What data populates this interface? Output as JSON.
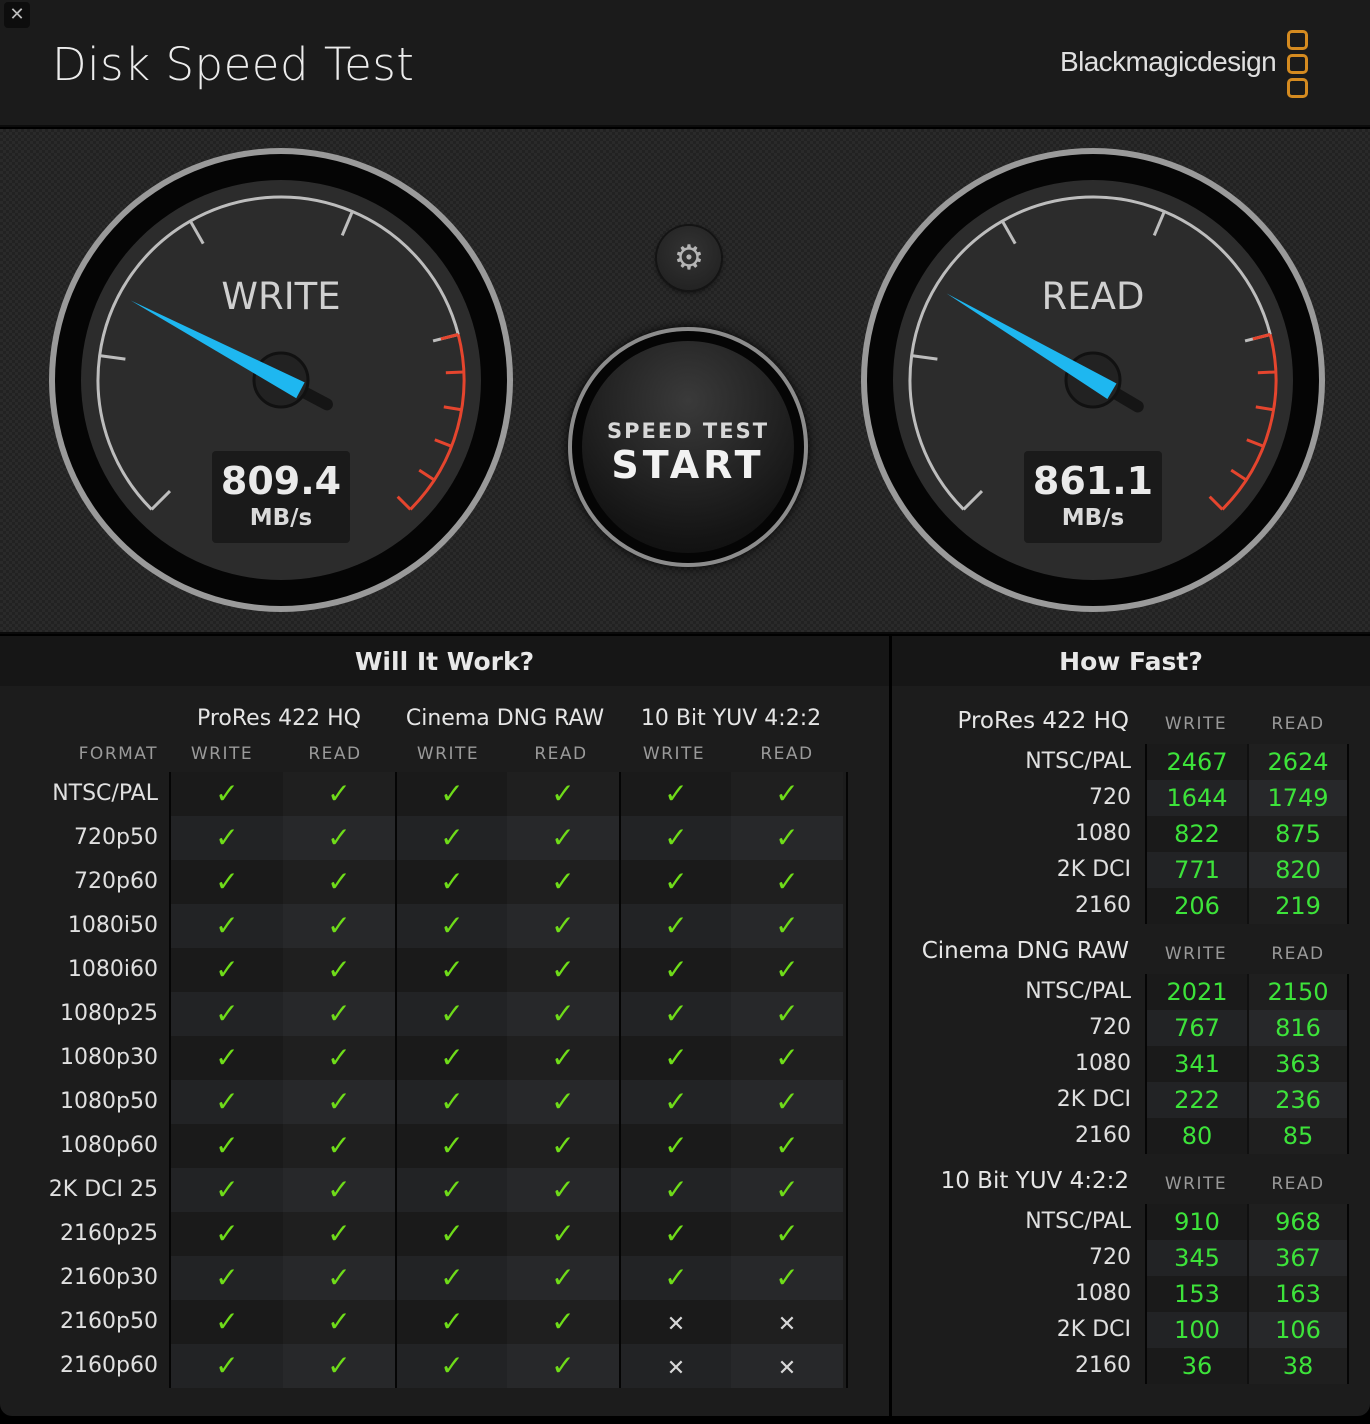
{
  "window": {
    "close_label": "✕"
  },
  "header": {
    "title": "Disk Speed Test",
    "brand": "Blackmagicdesign",
    "brand_color": "#d58b20"
  },
  "gauges": {
    "write": {
      "label": "WRITE",
      "value": "809.4",
      "unit": "MB/s",
      "needle_fraction": 0.27
    },
    "read": {
      "label": "READ",
      "value": "861.1",
      "unit": "MB/s",
      "needle_fraction": 0.28
    },
    "needle_color": "#1eb7f0",
    "redzone_color": "#e5452e"
  },
  "controls": {
    "settings_icon": "gear-icon",
    "start_sub_label": "SPEED TEST",
    "start_label": "START"
  },
  "will_it_work": {
    "title": "Will It Work?",
    "format_header": "FORMAT",
    "codecs": [
      "ProRes 422 HQ",
      "Cinema DNG RAW",
      "10 Bit YUV 4:2:2"
    ],
    "sub_headers": [
      "WRITE",
      "READ",
      "WRITE",
      "READ",
      "WRITE",
      "READ"
    ],
    "rows": [
      {
        "format": "NTSC/PAL",
        "results": [
          true,
          true,
          true,
          true,
          true,
          true
        ]
      },
      {
        "format": "720p50",
        "results": [
          true,
          true,
          true,
          true,
          true,
          true
        ]
      },
      {
        "format": "720p60",
        "results": [
          true,
          true,
          true,
          true,
          true,
          true
        ]
      },
      {
        "format": "1080i50",
        "results": [
          true,
          true,
          true,
          true,
          true,
          true
        ]
      },
      {
        "format": "1080i60",
        "results": [
          true,
          true,
          true,
          true,
          true,
          true
        ]
      },
      {
        "format": "1080p25",
        "results": [
          true,
          true,
          true,
          true,
          true,
          true
        ]
      },
      {
        "format": "1080p30",
        "results": [
          true,
          true,
          true,
          true,
          true,
          true
        ]
      },
      {
        "format": "1080p50",
        "results": [
          true,
          true,
          true,
          true,
          true,
          true
        ]
      },
      {
        "format": "1080p60",
        "results": [
          true,
          true,
          true,
          true,
          true,
          true
        ]
      },
      {
        "format": "2K DCI 25",
        "results": [
          true,
          true,
          true,
          true,
          true,
          true
        ]
      },
      {
        "format": "2160p25",
        "results": [
          true,
          true,
          true,
          true,
          true,
          true
        ]
      },
      {
        "format": "2160p30",
        "results": [
          true,
          true,
          true,
          true,
          true,
          true
        ]
      },
      {
        "format": "2160p50",
        "results": [
          true,
          true,
          true,
          true,
          false,
          false
        ]
      },
      {
        "format": "2160p60",
        "results": [
          true,
          true,
          true,
          true,
          false,
          false
        ]
      }
    ],
    "check_glyph": "✓",
    "cross_glyph": "✕"
  },
  "how_fast": {
    "title": "How Fast?",
    "write_header": "WRITE",
    "read_header": "READ",
    "sections": [
      {
        "codec": "ProRes 422 HQ",
        "rows": [
          {
            "format": "NTSC/PAL",
            "write": "2467",
            "read": "2624"
          },
          {
            "format": "720",
            "write": "1644",
            "read": "1749"
          },
          {
            "format": "1080",
            "write": "822",
            "read": "875"
          },
          {
            "format": "2K DCI",
            "write": "771",
            "read": "820"
          },
          {
            "format": "2160",
            "write": "206",
            "read": "219"
          }
        ]
      },
      {
        "codec": "Cinema DNG RAW",
        "rows": [
          {
            "format": "NTSC/PAL",
            "write": "2021",
            "read": "2150"
          },
          {
            "format": "720",
            "write": "767",
            "read": "816"
          },
          {
            "format": "1080",
            "write": "341",
            "read": "363"
          },
          {
            "format": "2K DCI",
            "write": "222",
            "read": "236"
          },
          {
            "format": "2160",
            "write": "80",
            "read": "85"
          }
        ]
      },
      {
        "codec": "10 Bit YUV 4:2:2",
        "rows": [
          {
            "format": "NTSC/PAL",
            "write": "910",
            "read": "968"
          },
          {
            "format": "720",
            "write": "345",
            "read": "367"
          },
          {
            "format": "1080",
            "write": "153",
            "read": "163"
          },
          {
            "format": "2K DCI",
            "write": "100",
            "read": "106"
          },
          {
            "format": "2160",
            "write": "36",
            "read": "38"
          }
        ]
      }
    ]
  }
}
